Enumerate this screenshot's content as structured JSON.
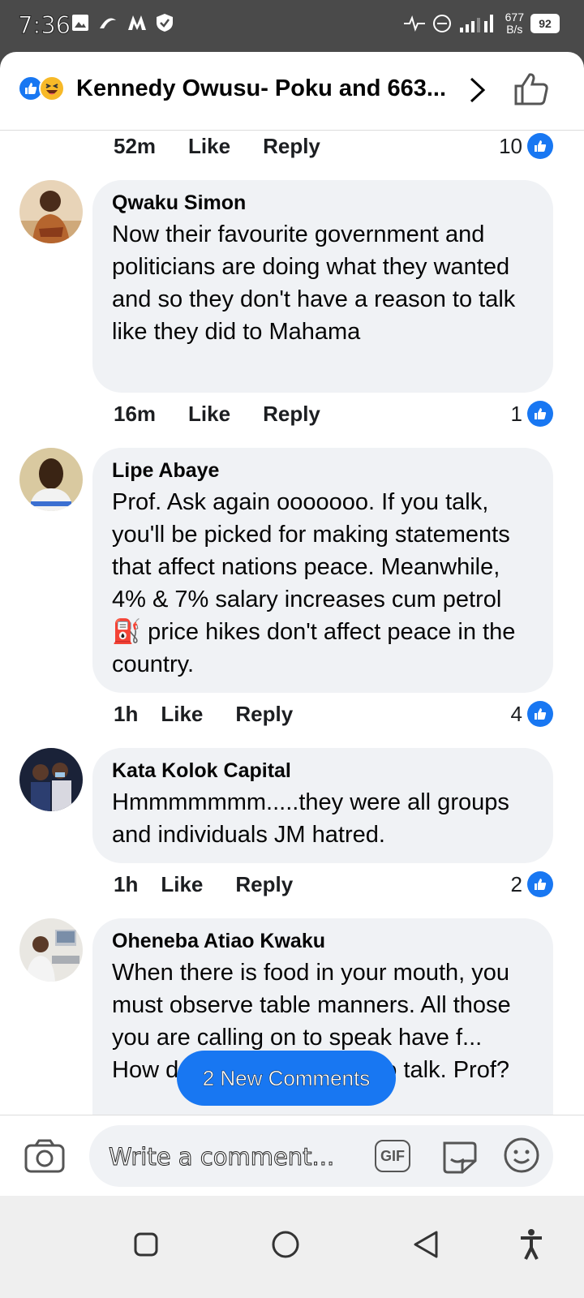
{
  "status_bar": {
    "time": "7:36",
    "net_speed_top": "677",
    "net_speed_bottom": "B/s",
    "battery": "92"
  },
  "header": {
    "title": "Kennedy Owusu- Poku and 663..."
  },
  "top_meta": {
    "time": "52m",
    "like": "Like",
    "reply": "Reply",
    "count": "10"
  },
  "comments": [
    {
      "author": "Qwaku Simon",
      "text": "Now their favourite government and politicians are doing what they wanted and so they don't have a reason to talk like they did to Mahama",
      "time": "16m",
      "like": "Like",
      "reply": "Reply",
      "count": "1"
    },
    {
      "author": "Lipe Abaye",
      "text_before": "Prof. Ask again ooooooo. If you talk, you'll be picked for making statements that affect nations peace. Meanwhile, 4% & 7% salary increases cum petrol ",
      "emoji": "⛽",
      "text_after": " price hikes don't affect peace in the country.",
      "time": "1h",
      "like": "Like",
      "reply": "Reply",
      "count": "4"
    },
    {
      "author": "Kata Kolok Capital",
      "text": "Hmmmmmmm.....they were all groups and individuals  JM hatred.",
      "time": "1h",
      "like": "Like",
      "reply": "Reply",
      "count": "2"
    },
    {
      "author": "Oheneba Atiao Kwaku",
      "text": "When there is food in your mouth, you must observe table manners. All those you are calling on to speak have f... How do you expect them to talk. Prof?"
    }
  ],
  "new_comments": "2 New Comments",
  "composer": {
    "placeholder": "Write a comment...",
    "gif": "GIF"
  },
  "colors": {
    "accent": "#1877f2",
    "bubble": "#f0f2f5"
  }
}
